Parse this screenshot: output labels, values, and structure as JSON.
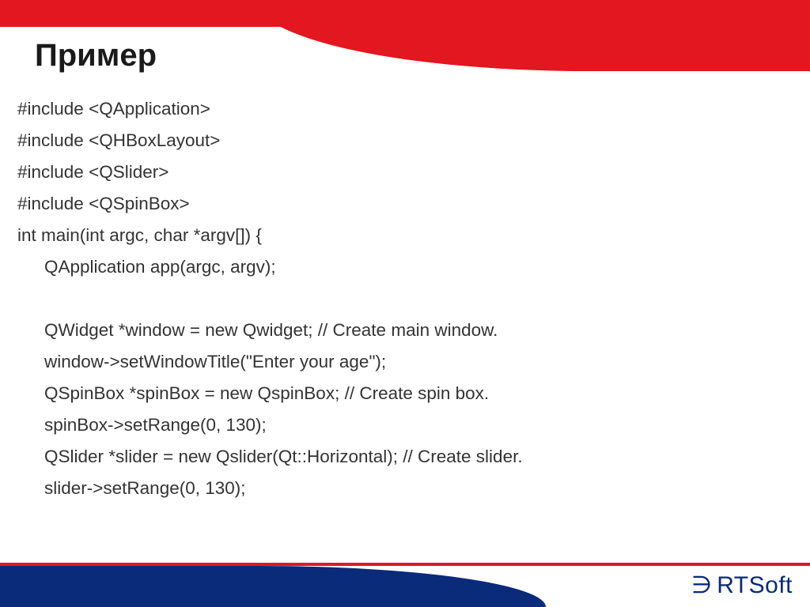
{
  "title": "Пример",
  "code": {
    "l1": "#include <QApplication>",
    "l2": "#include <QHBoxLayout>",
    "l3": "#include <QSlider>",
    "l4": "#include <QSpinBox>",
    "l5": "int main(int argc, char *argv[]) {",
    "l6": "QApplication app(argc, argv);",
    "l7": " ",
    "l8": "QWidget *window = new Qwidget; // Create main window.",
    "l9": "window->setWindowTitle(\"Enter your age\");",
    "l10": "QSpinBox *spinBox = new QspinBox; // Create spin box.",
    "l11": "spinBox->setRange(0, 130);",
    "l12": "QSlider *slider = new Qslider(Qt::Horizontal); // Create slider.",
    "l13": "slider->setRange(0, 130);"
  },
  "logo": {
    "mark": "∋",
    "text": "RTSoft"
  }
}
